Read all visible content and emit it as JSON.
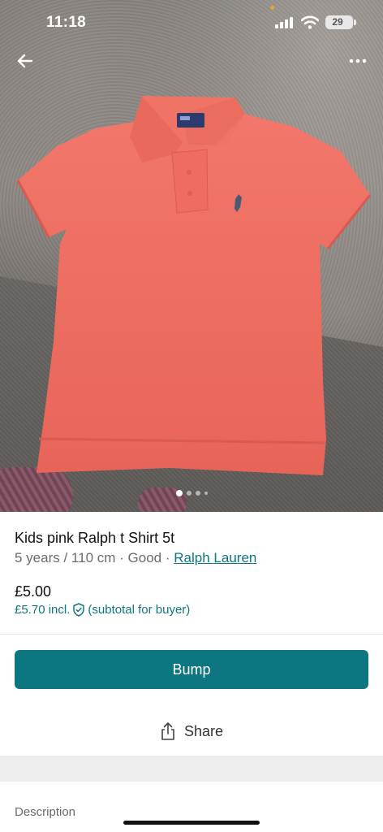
{
  "status_bar": {
    "time": "11:18",
    "battery": "29"
  },
  "item": {
    "title": "Kids pink Ralph t Shirt 5t",
    "size": "5 years / 110 cm",
    "condition": "Good",
    "separator": "·",
    "brand": "Ralph Lauren",
    "price": "£5.00",
    "buyer_price": "£5.70 incl.",
    "buyer_note": "(subtotal for buyer)"
  },
  "carousel": {
    "count": 4,
    "active_index": 0
  },
  "actions": {
    "bump_label": "Bump",
    "share_label": "Share"
  },
  "description": {
    "label": "Description"
  },
  "colors": {
    "accent": "#0e7681",
    "shirt": "#ee6a5e"
  },
  "icons": [
    "back-arrow-icon",
    "more-icon",
    "signal-icon",
    "wifi-icon",
    "battery-icon",
    "shield-check-icon",
    "share-icon"
  ]
}
